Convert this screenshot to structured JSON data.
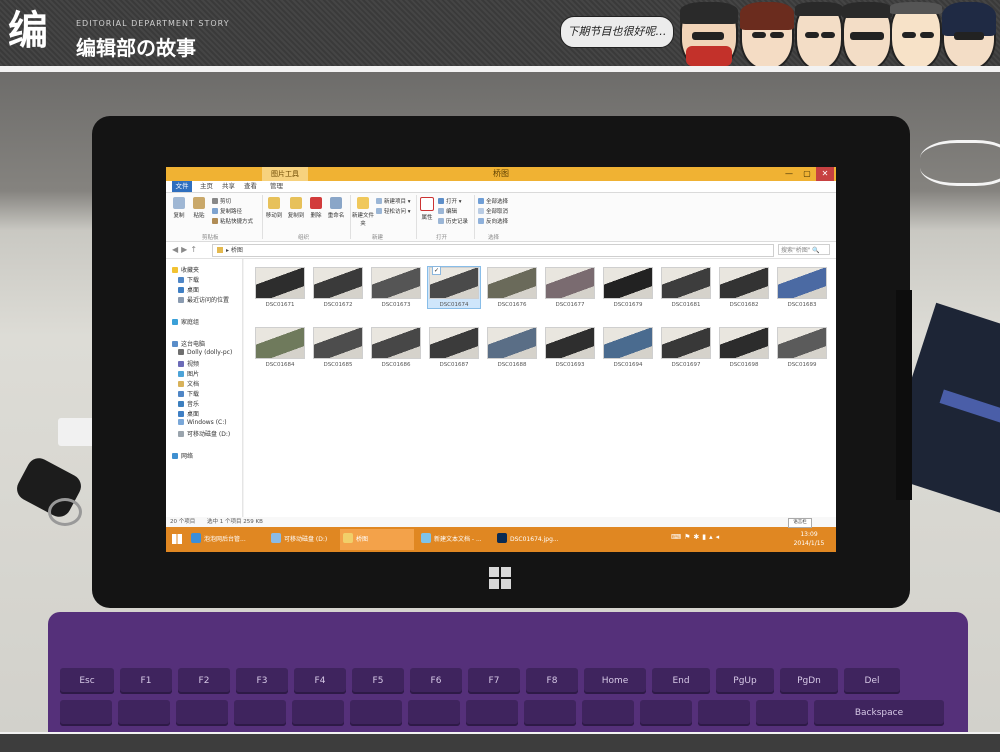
{
  "banner": {
    "logo_mark": "编",
    "logo_subtitle": "EDITORIAL DEPARTMENT STORY",
    "logo_title": "编辑部の故事",
    "speech_bubble": "下期节目也很好呢…"
  },
  "explorer": {
    "contextual_tab": "图片工具",
    "window_title": "桥图",
    "controls": [
      "—",
      "▢",
      "✕"
    ],
    "tabs": [
      "文件",
      "主页",
      "共享",
      "查看",
      "管理"
    ],
    "ribbon": {
      "copy": "复制",
      "paste": "粘贴",
      "cut": "剪切",
      "copy_path": "复制路径",
      "paste_shortcut": "粘贴快捷方式",
      "move_to": "移动到",
      "copy_to": "复制到",
      "delete": "删除",
      "rename": "重命名",
      "new_folder": "新建文件夹",
      "new_item": "新建项目 ▾",
      "easy_access": "轻松访问 ▾",
      "properties": "属性",
      "open": "打开 ▾",
      "edit": "编辑",
      "history": "历史记录",
      "select_all": "全部选择",
      "select_none": "全部取消",
      "invert_selection": "反向选择",
      "groups": [
        "剪贴板",
        "组织",
        "新建",
        "打开",
        "选择"
      ]
    },
    "address": {
      "path": "▸ 桥图",
      "search_placeholder": "搜索\"桥图\" 🔍"
    },
    "nav": {
      "favorites": "收藏夹",
      "downloads": "下载",
      "desktop": "桌面",
      "recent": "最近访问的位置",
      "homegroup": "家庭组",
      "this_pc": "这台电脑",
      "dolly": "Dolly (dolly-pc)",
      "videos": "视频",
      "pictures": "图片",
      "documents": "文档",
      "downloads2": "下载",
      "music": "音乐",
      "desktop2": "桌面",
      "windows_c": "Windows (C:)",
      "removable_d": "可移动磁盘 (D:)",
      "network": "网络"
    },
    "files": [
      "DSC01671",
      "DSC01672",
      "DSC01673",
      "DSC01674",
      "DSC01676",
      "DSC01677",
      "DSC01679",
      "DSC01681",
      "DSC01682",
      "DSC01683",
      "DSC01684",
      "DSC01685",
      "DSC01686",
      "DSC01687",
      "DSC01688",
      "DSC01693",
      "DSC01694",
      "DSC01697",
      "DSC01698",
      "DSC01699"
    ],
    "selected_file": "DSC01674",
    "status": {
      "count": "20 个项目",
      "selection": "选中 1 个项目  259 KB"
    },
    "taskbar": {
      "items": [
        "泡泡网后台管...",
        "可移动磁盘 (D:)",
        "桥图",
        "新建文本文档 - ...",
        "DSC01674.jpg..."
      ],
      "time": "13:09",
      "date": "2014/1/15",
      "notify_label": "语言栏"
    }
  },
  "keyboard": {
    "fn_row": [
      "Esc",
      "F1",
      "F2",
      "F3",
      "F4",
      "F5",
      "F6",
      "F7",
      "F8",
      "Home",
      "End",
      "PgUp",
      "PgDn",
      "Del"
    ],
    "number_row_end": "Backspace"
  },
  "colors": {
    "titlebar": "#f0b233",
    "taskbar": "#e08722",
    "keyboard": "#55307a",
    "file_tab": "#2f6fbf"
  }
}
